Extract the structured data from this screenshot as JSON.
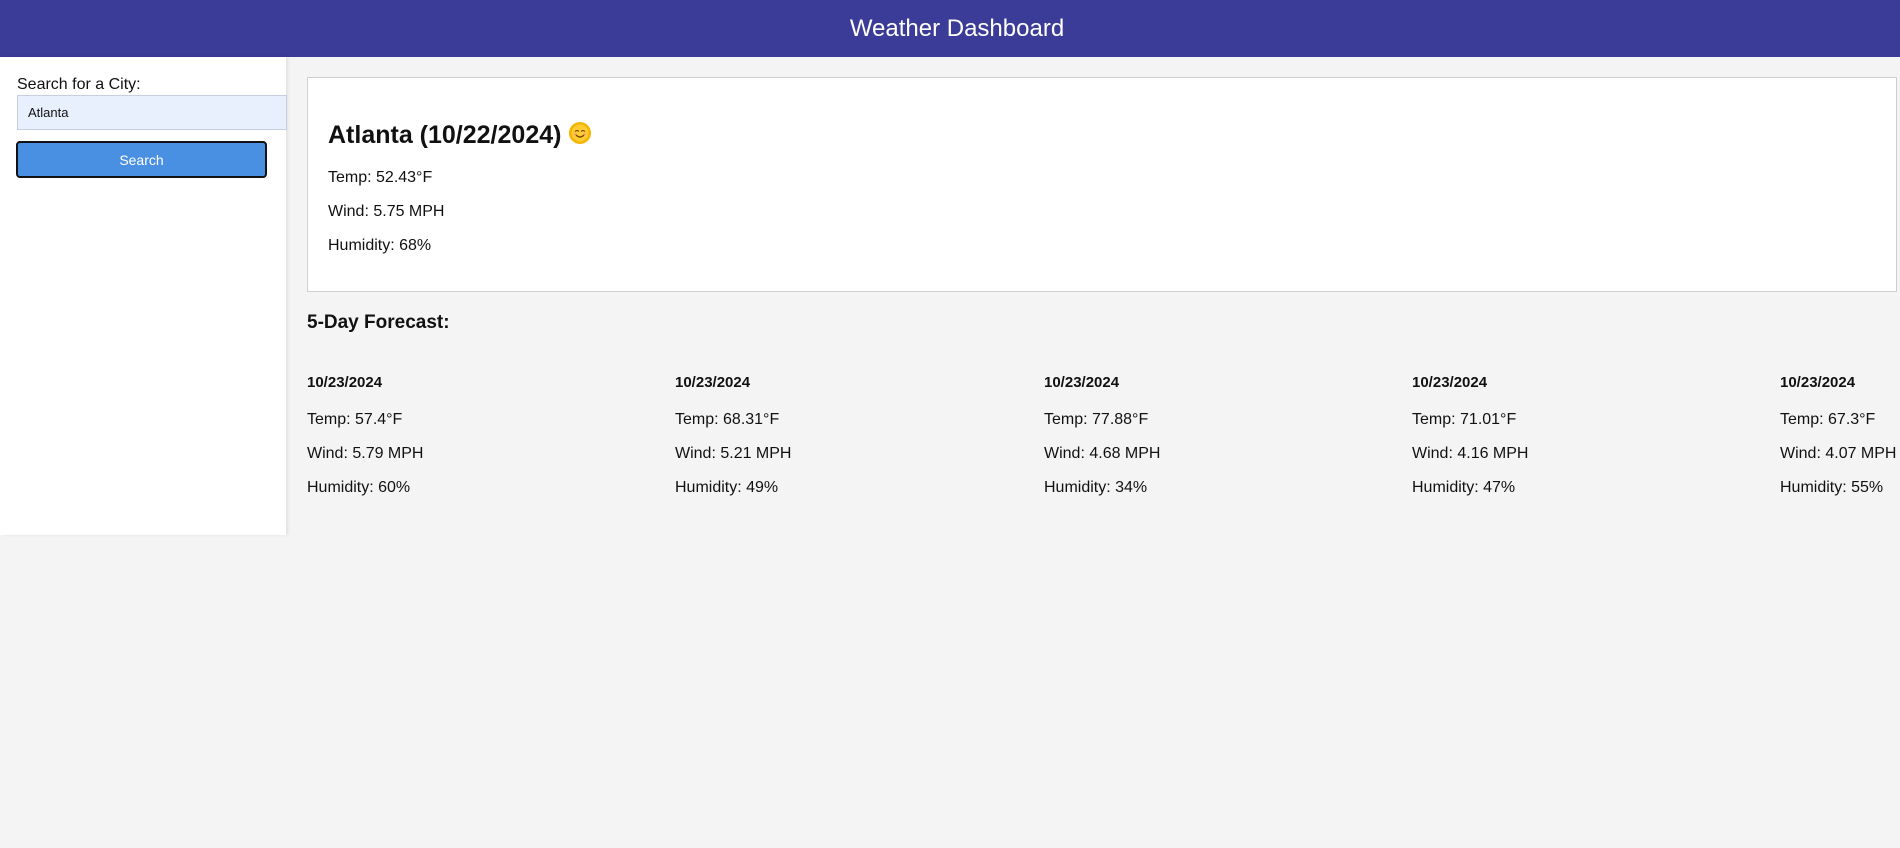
{
  "header": {
    "title": "Weather Dashboard",
    "color": "#3b3b98"
  },
  "sidebar": {
    "search_label": "Search for a City:",
    "search_value": "Atlanta",
    "search_button_label": "Search",
    "button_color": "#4a90e2"
  },
  "current": {
    "title": "Atlanta (10/22/2024)",
    "icon": "sun-face-icon",
    "temp": "Temp: 52.43°F",
    "wind": "Wind: 5.75 MPH",
    "humidity": "Humidity: 68%"
  },
  "forecast": {
    "heading": "5-Day Forecast:",
    "days": [
      {
        "date": "10/23/2024",
        "temp": "Temp: 57.4°F",
        "wind": "Wind: 5.79 MPH",
        "humidity": "Humidity: 60%"
      },
      {
        "date": "10/23/2024",
        "temp": "Temp: 68.31°F",
        "wind": "Wind: 5.21 MPH",
        "humidity": "Humidity: 49%"
      },
      {
        "date": "10/23/2024",
        "temp": "Temp: 77.88°F",
        "wind": "Wind: 4.68 MPH",
        "humidity": "Humidity: 34%"
      },
      {
        "date": "10/23/2024",
        "temp": "Temp: 71.01°F",
        "wind": "Wind: 4.16 MPH",
        "humidity": "Humidity: 47%"
      },
      {
        "date": "10/23/2024",
        "temp": "Temp: 67.3°F",
        "wind": "Wind: 4.07 MPH",
        "humidity": "Humidity: 55%"
      }
    ]
  }
}
